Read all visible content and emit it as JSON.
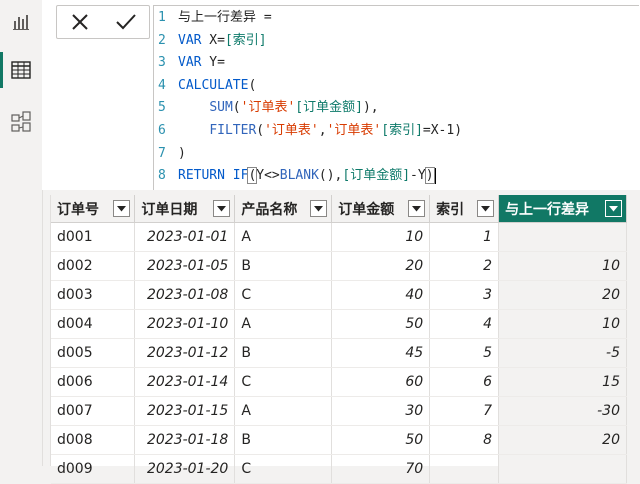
{
  "rail": {
    "icons": [
      "report-view-icon",
      "table-view-icon",
      "model-view-icon"
    ]
  },
  "formula": {
    "commit_icons": [
      "cancel-icon",
      "commit-icon"
    ],
    "lines": [
      {
        "n": "1",
        "parts": [
          [
            "t",
            "与上一行差异 ="
          ]
        ]
      },
      {
        "n": "2",
        "parts": [
          [
            "kw",
            "VAR"
          ],
          [
            "t",
            " X="
          ],
          [
            "col",
            "[索引]"
          ]
        ]
      },
      {
        "n": "3",
        "parts": [
          [
            "kw",
            "VAR"
          ],
          [
            "t",
            " Y="
          ]
        ]
      },
      {
        "n": "4",
        "parts": [
          [
            "fn",
            "CALCULATE"
          ],
          [
            "t",
            "("
          ]
        ]
      },
      {
        "n": "5",
        "parts": [
          [
            "t",
            "    "
          ],
          [
            "fn2",
            "SUM"
          ],
          [
            "t",
            "("
          ],
          [
            "str",
            "'订单表'"
          ],
          [
            "col",
            "[订单金额]"
          ],
          [
            "t",
            "),"
          ]
        ]
      },
      {
        "n": "6",
        "parts": [
          [
            "t",
            "    "
          ],
          [
            "fn2",
            "FILTER"
          ],
          [
            "t",
            "("
          ],
          [
            "str",
            "'订单表'"
          ],
          [
            "t",
            ","
          ],
          [
            "str",
            "'订单表'"
          ],
          [
            "col",
            "[索引]"
          ],
          [
            "t",
            "=X-1)"
          ]
        ]
      },
      {
        "n": "7",
        "parts": [
          [
            "t",
            ")"
          ]
        ]
      },
      {
        "n": "8",
        "parts": [
          [
            "kw",
            "RETURN"
          ],
          [
            "t",
            " "
          ],
          [
            "fn",
            "IF"
          ],
          [
            "box",
            "("
          ],
          [
            "t",
            "Y<>"
          ],
          [
            "fn2",
            "BLANK"
          ],
          [
            "t",
            "(),"
          ],
          [
            "col",
            "[订单金额]"
          ],
          [
            "t",
            "-Y"
          ],
          [
            "box",
            ")"
          ]
        ]
      }
    ]
  },
  "table": {
    "columns": [
      "订单号",
      "订单日期",
      "产品名称",
      "订单金额",
      "索引",
      "与上一行差异"
    ],
    "active_column": 5,
    "rows": [
      [
        "d001",
        "2023-01-01",
        "A",
        "10",
        "1",
        ""
      ],
      [
        "d002",
        "2023-01-05",
        "B",
        "20",
        "2",
        "10"
      ],
      [
        "d003",
        "2023-01-08",
        "C",
        "40",
        "3",
        "20"
      ],
      [
        "d004",
        "2023-01-10",
        "A",
        "50",
        "4",
        "10"
      ],
      [
        "d005",
        "2023-01-12",
        "B",
        "45",
        "5",
        "-5"
      ],
      [
        "d006",
        "2023-01-14",
        "C",
        "60",
        "6",
        "15"
      ],
      [
        "d007",
        "2023-01-15",
        "A",
        "30",
        "7",
        "-30"
      ],
      [
        "d008",
        "2023-01-18",
        "B",
        "50",
        "8",
        "20"
      ],
      [
        "d009",
        "2023-01-20",
        "C",
        "70",
        "",
        ""
      ]
    ]
  },
  "colors": {
    "accent": "#117865",
    "code_keyword": "#035aca",
    "code_string": "#d83b01",
    "code_column": "#0e7a6a",
    "line_number": "#2b91af"
  }
}
